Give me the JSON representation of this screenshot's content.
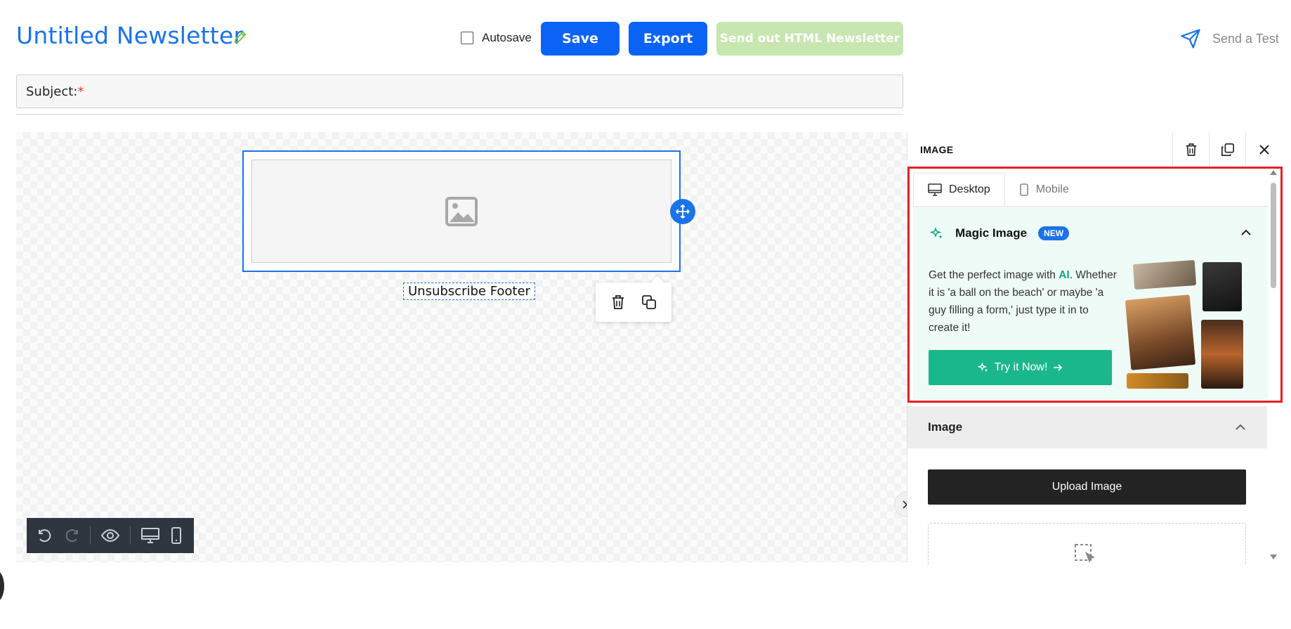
{
  "header": {
    "title": "Untitled Newsletter",
    "autosave_label": "Autosave",
    "save_label": "Save",
    "export_label": "Export",
    "send_label": "Send out HTML Newsletter",
    "send_test_label": "Send a Test"
  },
  "subject": {
    "label": "Subject:",
    "required_mark": "*"
  },
  "canvas": {
    "footer_label": "Unsubscribe Footer"
  },
  "panel": {
    "title": "IMAGE",
    "tabs": [
      {
        "label": "Desktop",
        "active": true
      },
      {
        "label": "Mobile",
        "active": false
      }
    ],
    "magic": {
      "title": "Magic Image",
      "badge": "NEW",
      "desc_prefix": "Get the perfect image with ",
      "desc_ai": "AI",
      "desc_suffix": ". Whether it is 'a ball on the beach' or maybe 'a guy filling a form,' just type it in to create it!",
      "try_label": "Try it Now!"
    },
    "image_section": {
      "title": "Image",
      "upload_label": "Upload Image"
    }
  },
  "colors": {
    "primary": "#0b63f6",
    "send_disabled": "#c7e6b0",
    "magic_bg": "#eefbf6",
    "try_button": "#1ab78b",
    "highlight": "#e32124"
  }
}
